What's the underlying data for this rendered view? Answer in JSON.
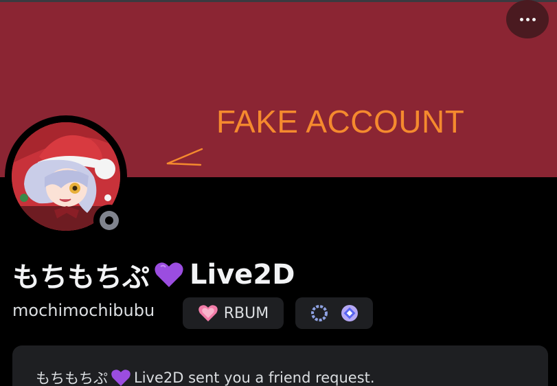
{
  "annotation": {
    "text": "FAKE ACCOUNT"
  },
  "profile": {
    "display_name_prefix": "もちもちぷ",
    "display_name_suffix": "Live2D",
    "username": "mochimochibubu",
    "status": "offline"
  },
  "tag": {
    "label": "RBUM",
    "icon": "pink-heart-icon"
  },
  "badges": [
    {
      "icon": "laurel-badge-icon"
    },
    {
      "icon": "quest-badge-icon"
    }
  ],
  "friend_request": {
    "name_prefix": "もちもちぷ",
    "message_suffix": "Live2D sent you a friend request."
  },
  "colors": {
    "banner": "#8b2533",
    "annotation": "#f58a2e",
    "background": "#000000",
    "card": "#1e1f22",
    "heart_purple": "#9b4de0"
  }
}
